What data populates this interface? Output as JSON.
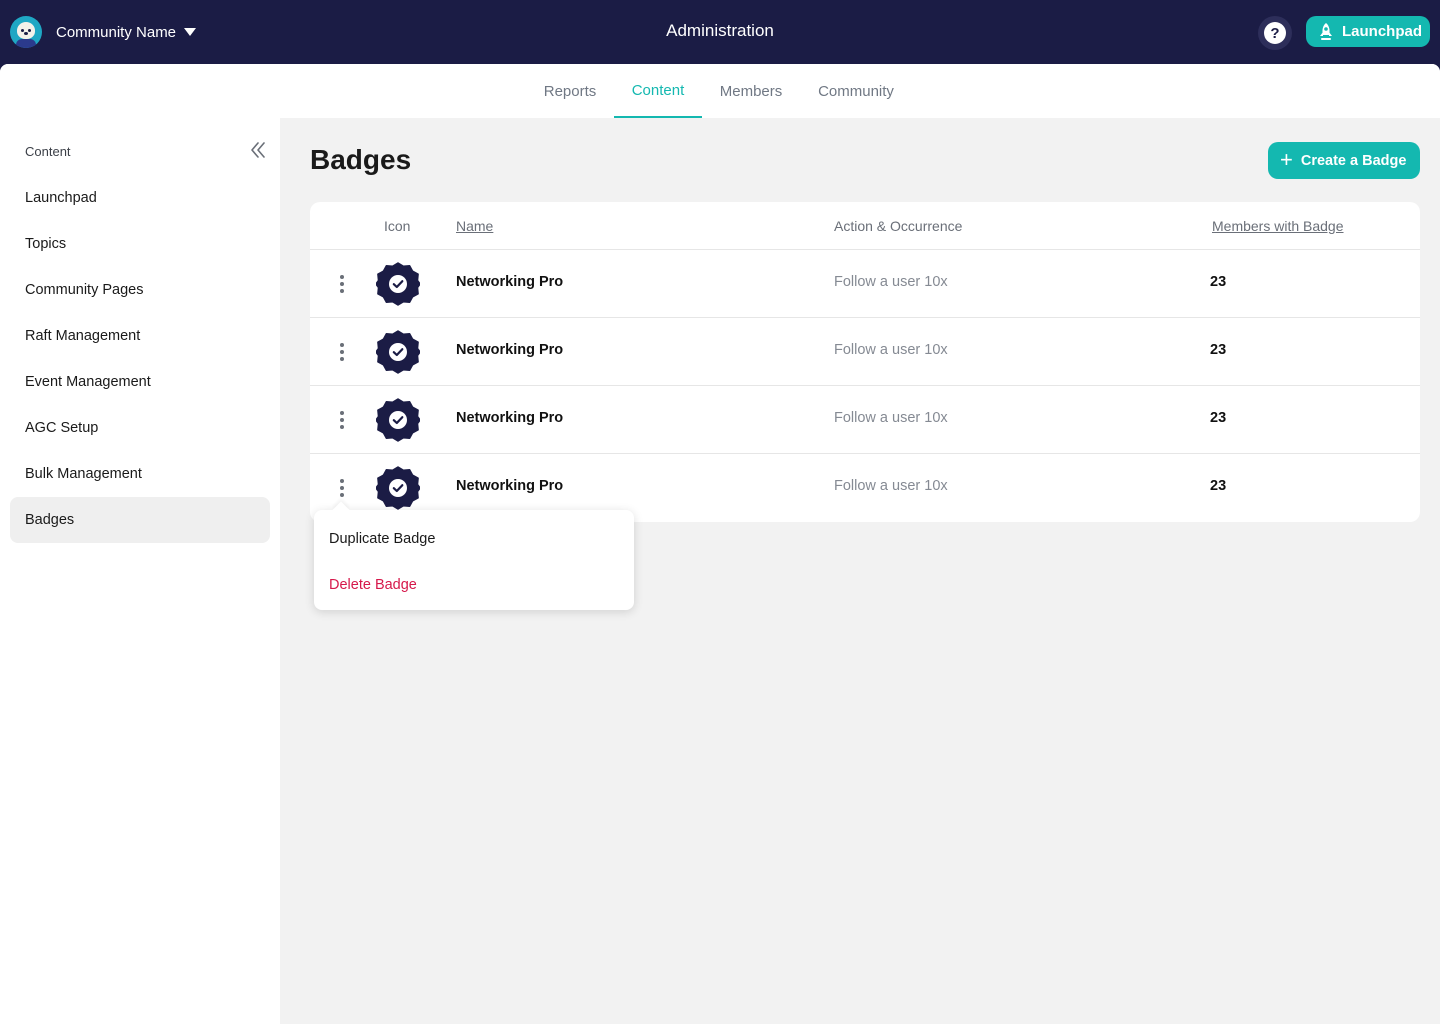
{
  "header": {
    "community_name": "Community Name",
    "title": "Administration",
    "help_icon": "question-circle-icon",
    "launchpad_label": "Launchpad"
  },
  "tabs": [
    {
      "label": "Reports",
      "active": false
    },
    {
      "label": "Content",
      "active": true
    },
    {
      "label": "Members",
      "active": false
    },
    {
      "label": "Community",
      "active": false
    }
  ],
  "sidebar": {
    "heading": "Content",
    "items": [
      {
        "label": "Launchpad"
      },
      {
        "label": "Topics"
      },
      {
        "label": "Community Pages"
      },
      {
        "label": "Raft Management"
      },
      {
        "label": "Event Management"
      },
      {
        "label": "AGC Setup"
      },
      {
        "label": "Bulk Management"
      },
      {
        "label": "Badges",
        "active": true
      }
    ]
  },
  "main": {
    "title": "Badges",
    "create_label": "Create a Badge"
  },
  "table": {
    "columns": {
      "icon": "Icon",
      "name": "Name",
      "action": "Action & Occurrence",
      "members": "Members with Badge"
    },
    "rows": [
      {
        "name": "Networking Pro",
        "action": "Follow a user 10x",
        "members": "23"
      },
      {
        "name": "Networking Pro",
        "action": "Follow a user 10x",
        "members": "23"
      },
      {
        "name": "Networking Pro",
        "action": "Follow a user 10x",
        "members": "23"
      },
      {
        "name": "Networking Pro",
        "action": "Follow a user 10x",
        "members": "23"
      }
    ]
  },
  "row_menu": {
    "duplicate_label": "Duplicate Badge",
    "delete_label": "Delete Badge"
  },
  "colors": {
    "header_bg": "#1b1c45",
    "accent": "#14b8b0",
    "danger": "#d6184b",
    "badge_fill": "#1b1c45"
  }
}
